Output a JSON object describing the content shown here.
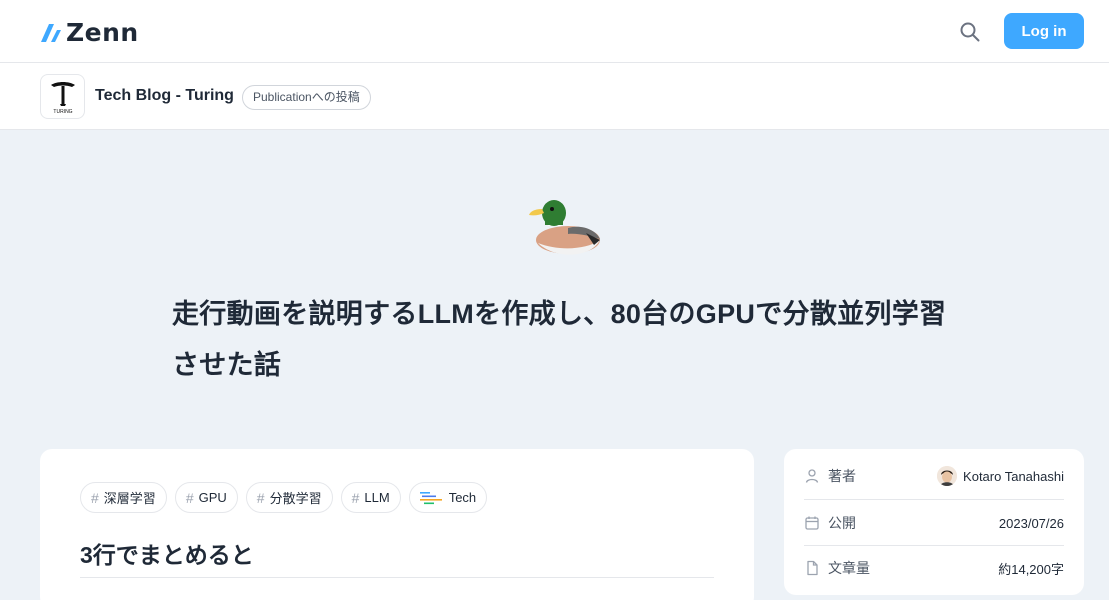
{
  "header": {
    "logo_text": "Zenn",
    "login_label": "Log in",
    "icons": [
      "zenn-logo-icon",
      "search-icon"
    ]
  },
  "publication": {
    "name": "Tech Blog - Turing",
    "logo_text": "TURING",
    "badge": "Publicationへの投稿"
  },
  "article": {
    "emoji": "mallard-duck",
    "title": "走行動画を説明するLLMを作成し、80台のGPUで分散並列学習させた話",
    "tags": [
      {
        "label": "深層学習",
        "type": "hash"
      },
      {
        "label": "GPU",
        "type": "hash"
      },
      {
        "label": "分散学習",
        "type": "hash"
      },
      {
        "label": "LLM",
        "type": "hash"
      },
      {
        "label": "Tech",
        "type": "icon"
      }
    ],
    "section_heading": "3行でまとめると"
  },
  "sidebar": {
    "author_label": "著者",
    "author_name": "Kotaro Tanahashi",
    "published_label": "公開",
    "published_date": "2023/07/26",
    "length_label": "文章量",
    "length_value": "約14,200字"
  },
  "colors": {
    "accent": "#3ea8ff",
    "background": "#edf2f7",
    "text": "#1f2937"
  }
}
